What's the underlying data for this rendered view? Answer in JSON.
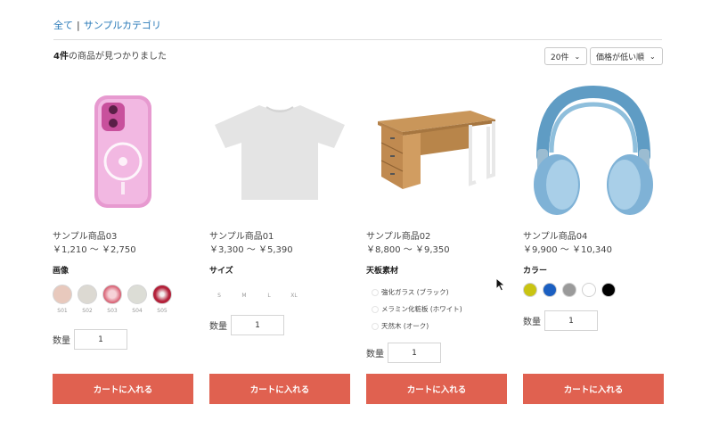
{
  "breadcrumb": {
    "all": "全て",
    "sep": "|",
    "category": "サンプルカテゴリ"
  },
  "results": {
    "count": "4件",
    "text": "の商品が見つかりました"
  },
  "per_page": {
    "selected": "20件"
  },
  "sort": {
    "selected": "価格が低い順"
  },
  "products": [
    {
      "name": "サンプル商品03",
      "price": "￥1,210 〜 ￥2,750",
      "option_title": "画像",
      "swatches": [
        "S01",
        "S02",
        "S03",
        "S04",
        "S05"
      ],
      "qty_label": "数量",
      "qty": "1",
      "button": "カートに入れる"
    },
    {
      "name": "サンプル商品01",
      "price": "￥3,300 〜 ￥5,390",
      "option_title": "サイズ",
      "sizes": [
        "S",
        "M",
        "L",
        "XL"
      ],
      "qty_label": "数量",
      "qty": "1",
      "button": "カートに入れる"
    },
    {
      "name": "サンプル商品02",
      "price": "￥8,800 〜 ￥9,350",
      "option_title": "天板素材",
      "materials": [
        "強化ガラス (ブラック)",
        "メラミン化粧板 (ホワイト)",
        "天然木 (オーク)"
      ],
      "qty_label": "数量",
      "qty": "1",
      "button": "カートに入れる"
    },
    {
      "name": "サンプル商品04",
      "price": "￥9,900 〜 ￥10,340",
      "option_title": "カラー",
      "colors": [
        "#c9c412",
        "#1b5fc1",
        "#9a9a9a",
        "#ffffff",
        "#000000"
      ],
      "qty_label": "数量",
      "qty": "1",
      "button": "カートに入れる"
    }
  ]
}
